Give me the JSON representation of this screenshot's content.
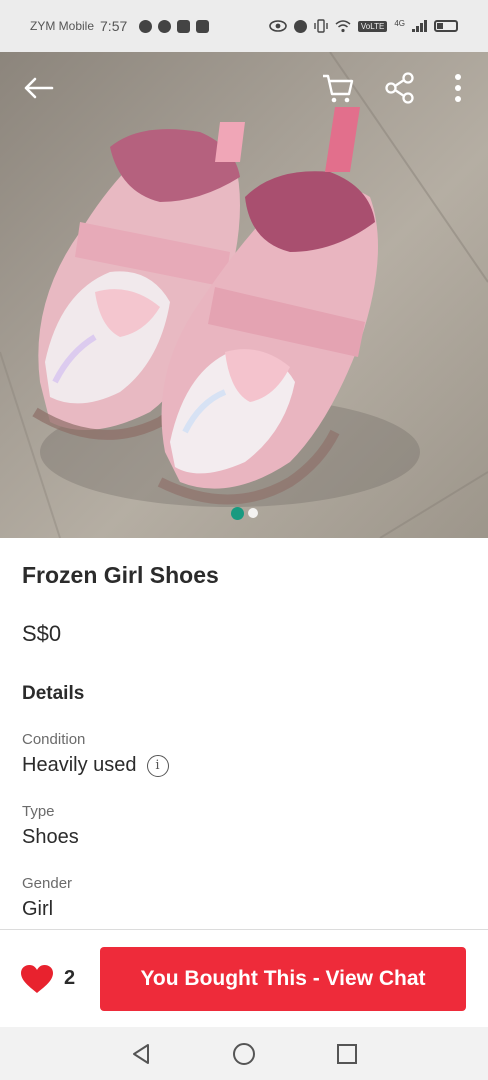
{
  "status_bar": {
    "carrier": "ZYM Mobile",
    "time": "7:57",
    "network": "4G",
    "volte": "VoLTE"
  },
  "hero": {
    "image_description_icon": "product-photo",
    "carousel": {
      "total": 2,
      "current": 1
    },
    "back_icon": "arrow-left-icon",
    "cart_icon": "cart-icon",
    "share_icon": "share-icon",
    "more_icon": "more-vertical-icon"
  },
  "listing": {
    "title": "Frozen Girl Shoes",
    "price": "S$0",
    "details_heading": "Details",
    "details": [
      {
        "label": "Condition",
        "value": "Heavily used",
        "info": "i"
      },
      {
        "label": "Type",
        "value": "Shoes"
      },
      {
        "label": "Gender",
        "value": "Girl"
      }
    ]
  },
  "actions": {
    "like_count": "2",
    "cta_label": "You Bought This - View Chat"
  },
  "colors": {
    "accent": "#ee2b3a",
    "carousel_active": "#199a80",
    "heart": "#e8222e"
  }
}
